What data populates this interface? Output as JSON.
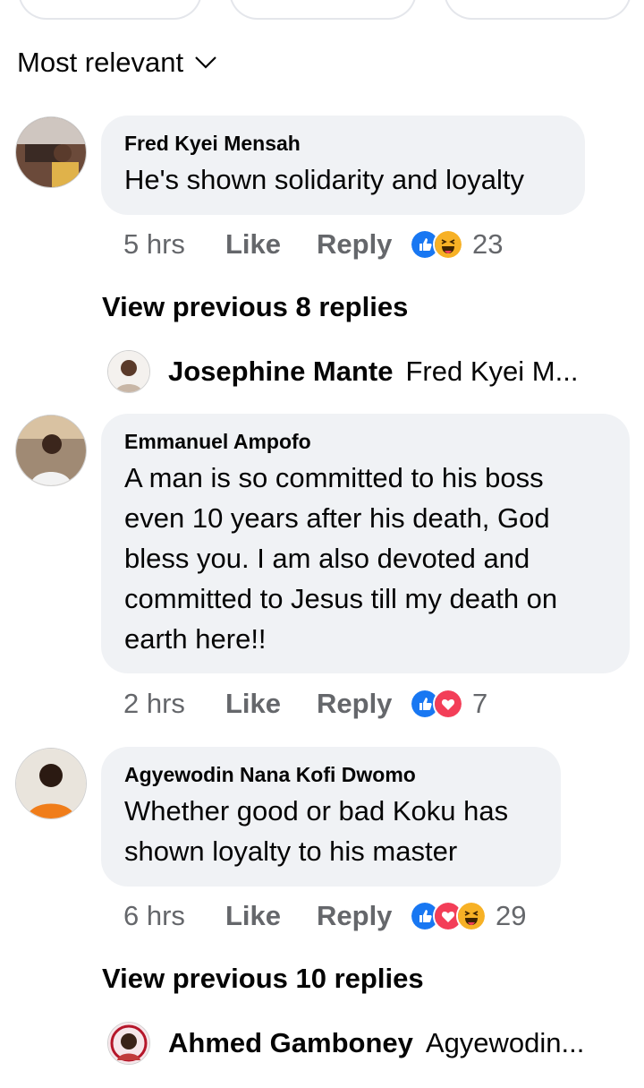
{
  "sort": {
    "label": "Most relevant"
  },
  "comments": [
    {
      "author": "Fred Kyei Mensah",
      "text": "He's shown solidarity and loyalty",
      "time": "5 hrs",
      "like": "Like",
      "reply": "Reply",
      "reactions": [
        "like",
        "haha"
      ],
      "reaction_count": "23"
    },
    {
      "author": "Emmanuel Ampofo",
      "text": "A man is so committed to his boss even 10 years after his death, God bless you. I am also devoted and committed to Jesus till my death on earth here!!",
      "time": "2 hrs",
      "like": "Like",
      "reply": "Reply",
      "reactions": [
        "like",
        "love"
      ],
      "reaction_count": "7"
    },
    {
      "author": "Agyewodin Nana Kofi Dwomo",
      "text": "Whether good or bad Koku has shown loyalty to his master",
      "time": "6 hrs",
      "like": "Like",
      "reply": "Reply",
      "reactions": [
        "like",
        "love",
        "haha"
      ],
      "reaction_count": "29"
    }
  ],
  "threads": [
    {
      "view_previous": "View previous 8 replies",
      "reply_author": "Josephine Mante",
      "reply_preview": "Fred Kyei M..."
    },
    {
      "view_previous": "View previous 10 replies",
      "reply_author": "Ahmed Gamboney",
      "reply_preview": "Agyewodin..."
    }
  ],
  "colors": {
    "like_blue": "#1877f2",
    "love_red": "#f33e58",
    "haha_yellow": "#f7b125",
    "meta_gray": "#65676b",
    "bubble_bg": "#f0f2f5"
  }
}
